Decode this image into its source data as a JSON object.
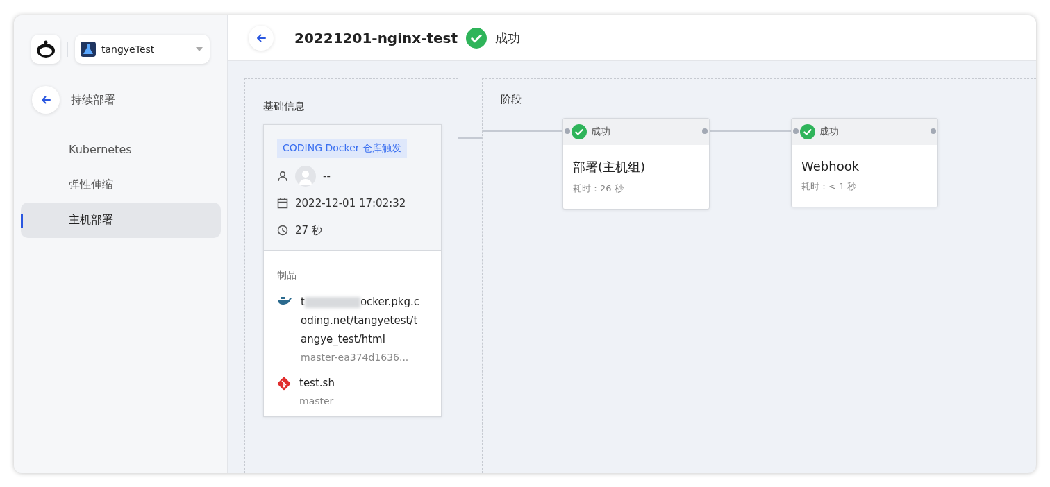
{
  "sidebar": {
    "project": {
      "name": "tangyeTest"
    },
    "back_label": "持续部署",
    "items": [
      {
        "label": "Kubernetes",
        "selected": false
      },
      {
        "label": "弹性伸缩",
        "selected": false
      },
      {
        "label": "主机部署",
        "selected": true
      }
    ]
  },
  "header": {
    "title": "20221201-nginx-test",
    "kind": "success",
    "status_label": "成功"
  },
  "basic_info": {
    "title": "基础信息",
    "trigger": "CODING Docker 仓库触发",
    "user": "--",
    "time": "2022-12-01 17:02:32",
    "duration": "27 秒",
    "artifacts_title": "制品",
    "artifacts": [
      {
        "kind": "docker",
        "name_start": "t",
        "name_end": "ocker.pkg.coding.net/tangyetest/tangye_test/html",
        "version": "master-ea374d1636..."
      },
      {
        "kind": "git",
        "name_start": "test.sh",
        "version": "master"
      }
    ]
  },
  "stages": {
    "title": "阶段",
    "items": [
      {
        "kind": "success",
        "status_label": "成功",
        "name": "部署(主机组)",
        "duration": "耗时：26 秒"
      },
      {
        "kind": "success",
        "status_label": "成功",
        "name": "Webhook",
        "duration": "耗时：< 1 秒"
      }
    ]
  }
}
